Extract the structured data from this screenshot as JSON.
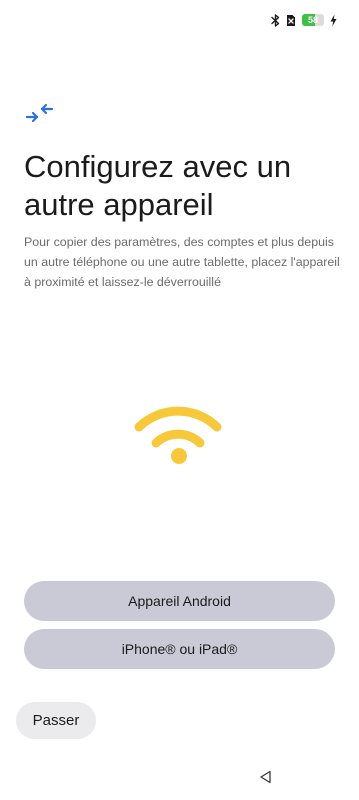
{
  "status_bar": {
    "battery_level": "58",
    "icons": [
      "bluetooth-icon",
      "sim-card-no-signal-icon",
      "battery-icon",
      "charging-bolt-icon"
    ],
    "battery_color": "#3fbf4a"
  },
  "header": {
    "icon": "arrows-transfer-icon",
    "icon_color": "#2f6fe0"
  },
  "main": {
    "title": "Configurez avec un autre appareil",
    "description": "Pour copier des paramètres, des comptes et plus depuis un autre téléphone ou une autre tablette, placez l'appareil à proximité et laissez-le déverrouillé",
    "illustration": "wifi-signal-icon",
    "illustration_color": "#f7c83a"
  },
  "options": {
    "android_label": "Appareil Android",
    "iphone_label": "iPhone® ou iPad®"
  },
  "footer": {
    "skip_label": "Passer"
  },
  "navigation": {
    "back_icon": "back-triangle-icon"
  }
}
